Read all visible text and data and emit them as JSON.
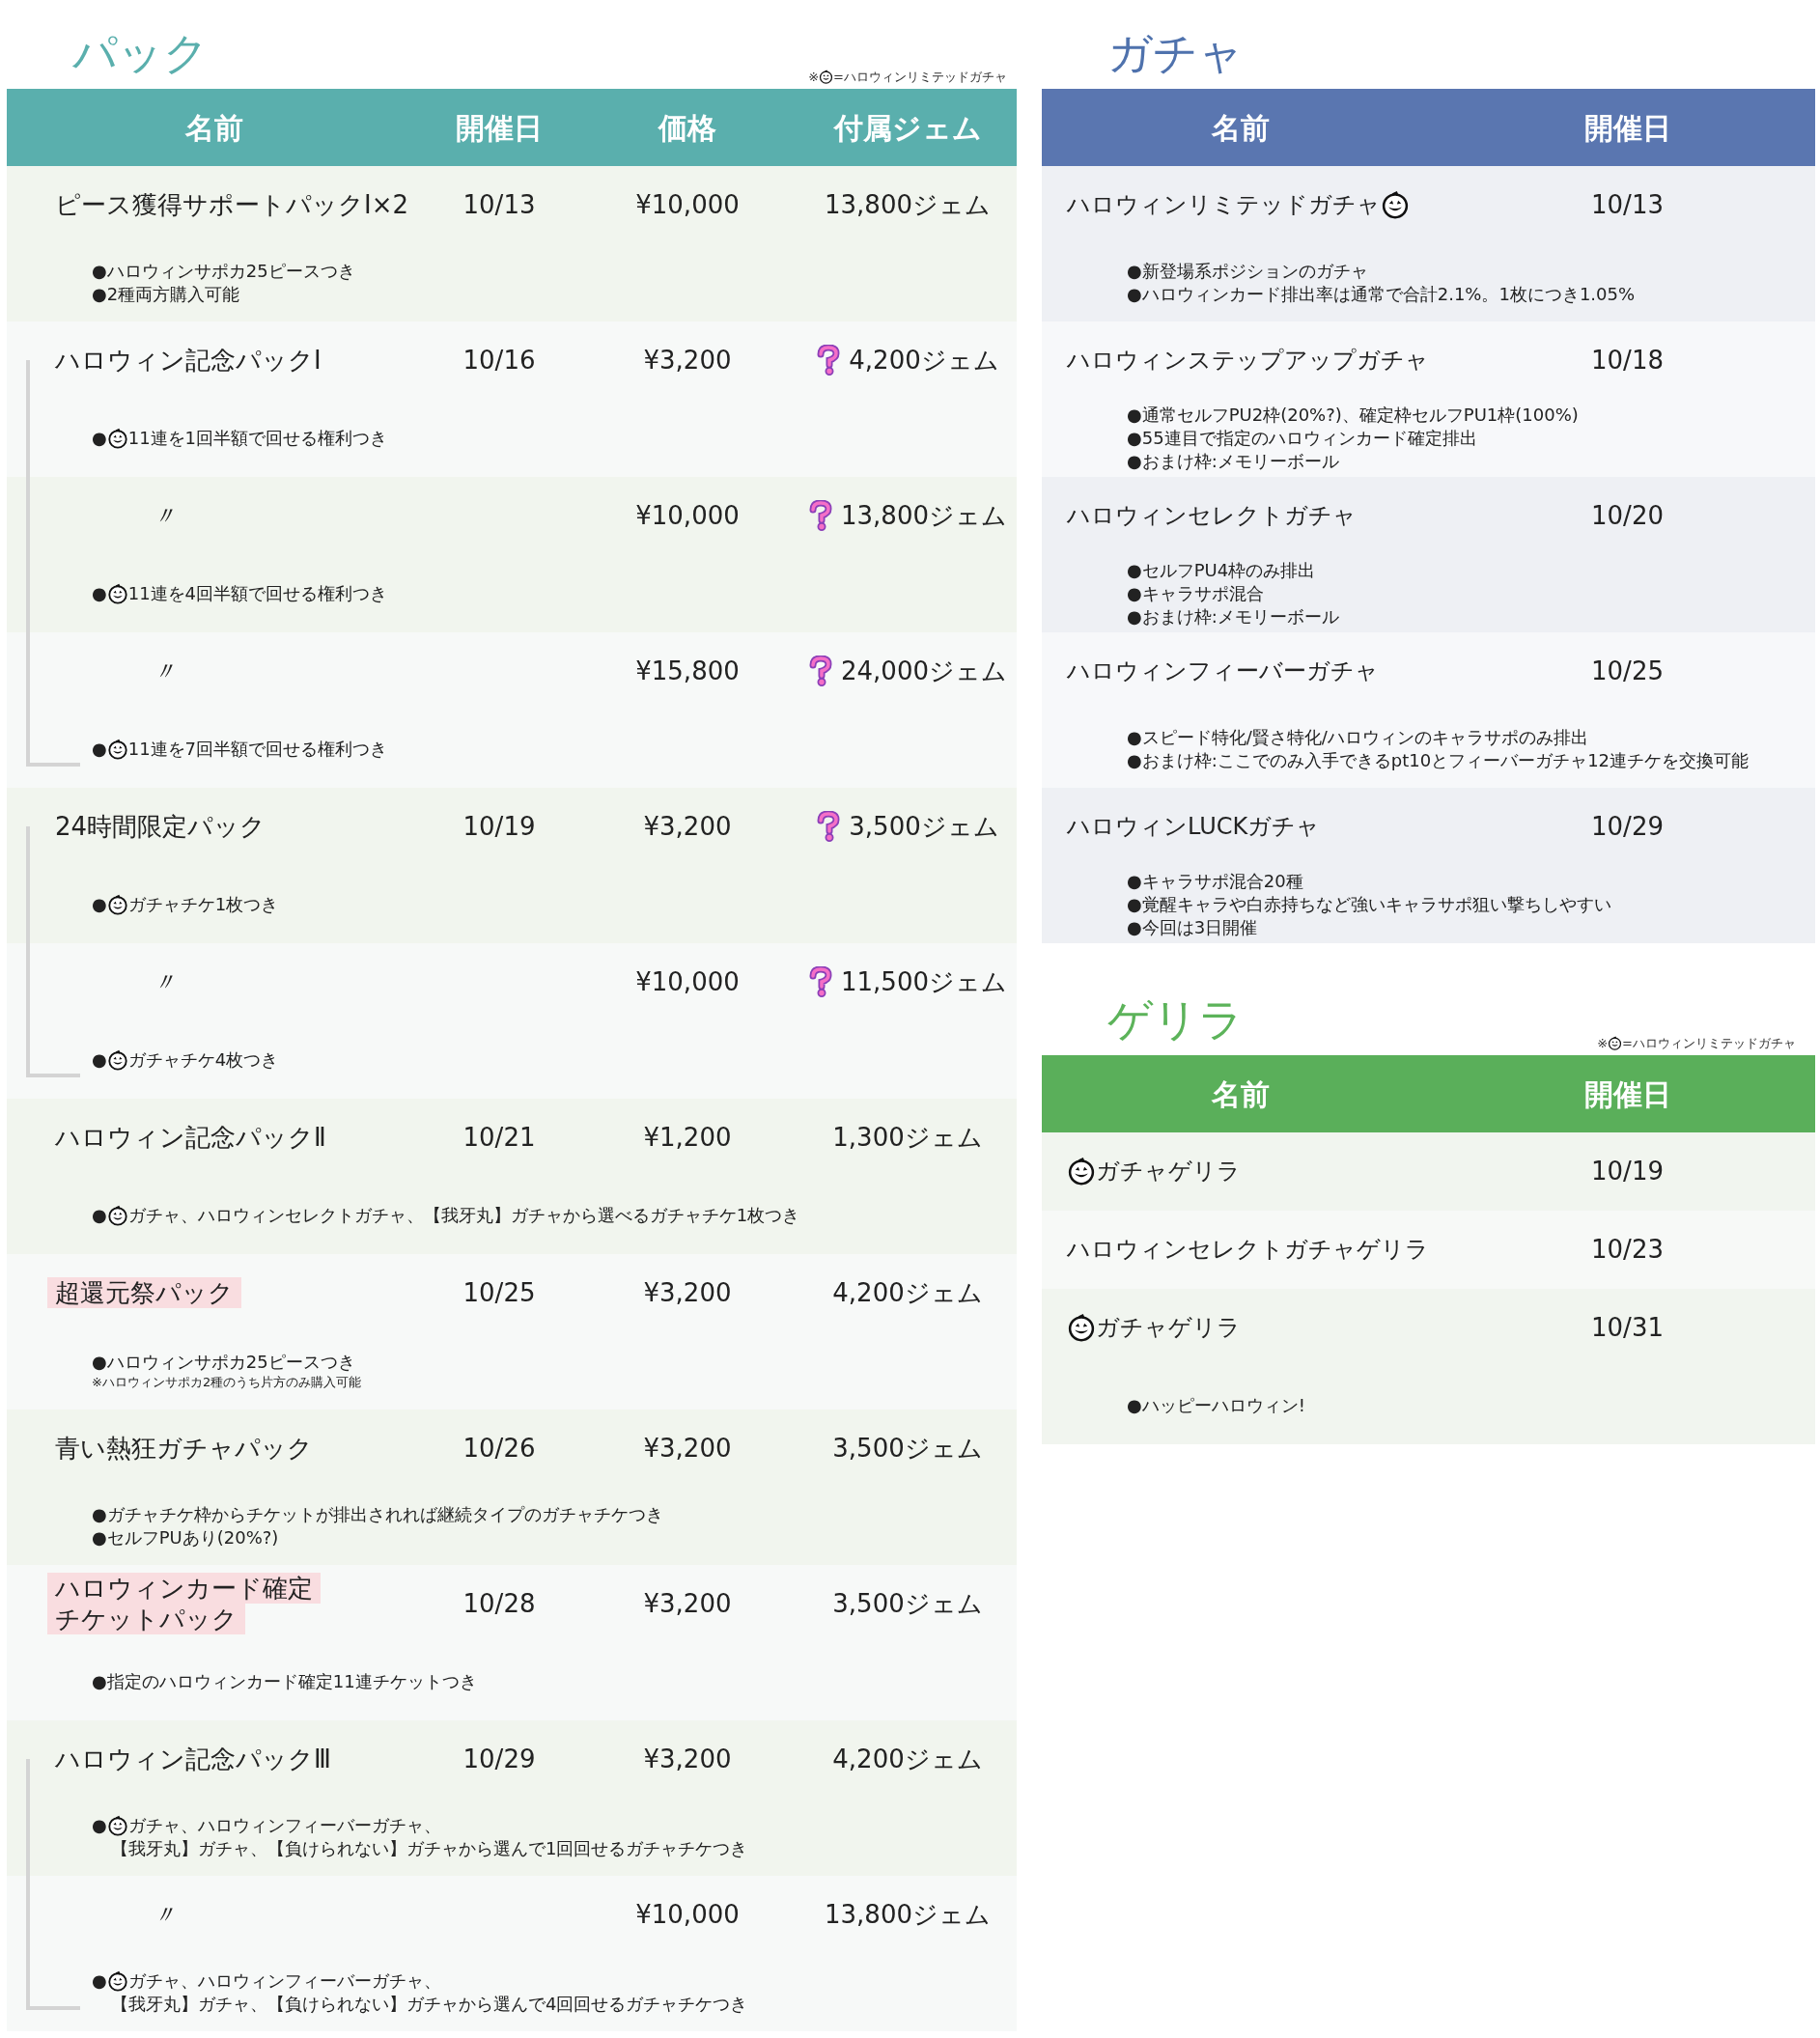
{
  "packs": {
    "title": "パック",
    "legend": {
      "lead": "※",
      "text": "=ハロウィンリミテッドガチャ"
    },
    "columns": [
      "名前",
      "開催日",
      "価格",
      "付属ジェム"
    ],
    "groups": [
      {
        "name": [
          "ピース獲得サポートパックⅠ×2"
        ],
        "date": "10/13",
        "highlight": false,
        "variants": [
          {
            "price": "¥10,000",
            "gems": "13,800ジェム",
            "gem_bonus": false,
            "notes": [
              {
                "text": "●ハロウィンサポカ25ピースつき"
              },
              {
                "text": "●2種両方購入可能"
              }
            ]
          }
        ]
      },
      {
        "name": [
          "ハロウィン記念パックⅠ"
        ],
        "date": "10/16",
        "highlight": false,
        "variants": [
          {
            "price": "¥3,200",
            "gems": "4,200ジェム",
            "gem_bonus": true,
            "notes": [
              {
                "lead": "●",
                "pumpkin": true,
                "text": "11連を1回半額で回せる権利つき"
              }
            ]
          },
          {
            "ditto": "〃",
            "price": "¥10,000",
            "gems": "13,800ジェム",
            "gem_bonus": true,
            "notes": [
              {
                "lead": "●",
                "pumpkin": true,
                "text": "11連を4回半額で回せる権利つき"
              }
            ]
          },
          {
            "ditto": "〃",
            "price": "¥15,800",
            "gems": "24,000ジェム",
            "gem_bonus": true,
            "notes": [
              {
                "lead": "●",
                "pumpkin": true,
                "text": "11連を7回半額で回せる権利つき"
              }
            ]
          }
        ]
      },
      {
        "name": [
          "24時間限定パック"
        ],
        "date": "10/19",
        "highlight": false,
        "variants": [
          {
            "price": "¥3,200",
            "gems": "3,500ジェム",
            "gem_bonus": true,
            "notes": [
              {
                "lead": "●",
                "pumpkin": true,
                "text": "ガチャチケ1枚つき"
              }
            ]
          },
          {
            "ditto": "〃",
            "price": "¥10,000",
            "gems": "11,500ジェム",
            "gem_bonus": true,
            "notes": [
              {
                "lead": "●",
                "pumpkin": true,
                "text": "ガチャチケ4枚つき"
              }
            ]
          }
        ]
      },
      {
        "name": [
          "ハロウィン記念パックⅡ"
        ],
        "date": "10/21",
        "highlight": false,
        "variants": [
          {
            "price": "¥1,200",
            "gems": "1,300ジェム",
            "gem_bonus": false,
            "notes": [
              {
                "lead": "●",
                "pumpkin": true,
                "text": "ガチャ、ハロウィンセレクトガチャ、【我牙丸】ガチャから選べるガチャチケ1枚つき"
              }
            ]
          }
        ]
      },
      {
        "name": [
          "超還元祭パック"
        ],
        "date": "10/25",
        "highlight": true,
        "variants": [
          {
            "price": "¥3,200",
            "gems": "4,200ジェム",
            "gem_bonus": false,
            "notes": [
              {
                "text": "●ハロウィンサポカ25ピースつき"
              },
              {
                "kind": "small",
                "text": "※ハロウィンサポカ2種のうち片方のみ購入可能"
              }
            ]
          }
        ]
      },
      {
        "name": [
          "青い熱狂ガチャパック"
        ],
        "date": "10/26",
        "highlight": false,
        "variants": [
          {
            "price": "¥3,200",
            "gems": "3,500ジェム",
            "gem_bonus": false,
            "notes": [
              {
                "text": "●ガチャチケ枠からチケットが排出されれば継続タイプのガチャチケつき"
              },
              {
                "text": "●セルフPUあり(20%?)"
              }
            ]
          }
        ]
      },
      {
        "name": [
          "ハロウィンカード確定",
          "チケットパック"
        ],
        "date": "10/28",
        "highlight": true,
        "variants": [
          {
            "price": "¥3,200",
            "gems": "3,500ジェム",
            "gem_bonus": false,
            "notes": [
              {
                "text": "●指定のハロウィンカード確定11連チケットつき"
              }
            ]
          }
        ]
      },
      {
        "name": [
          "ハロウィン記念パックⅢ"
        ],
        "date": "10/29",
        "highlight": false,
        "variants": [
          {
            "price": "¥3,200",
            "gems": "4,200ジェム",
            "gem_bonus": false,
            "notes": [
              {
                "lead": "●",
                "pumpkin": true,
                "text": "ガチャ、ハロウィンフィーバーガチャ、"
              },
              {
                "kind": "continuation",
                "text": "【我牙丸】ガチャ、【負けられない】ガチャから選んで1回回せるガチャチケつき"
              }
            ]
          },
          {
            "ditto": "〃",
            "price": "¥10,000",
            "gems": "13,800ジェム",
            "gem_bonus": false,
            "notes": [
              {
                "lead": "●",
                "pumpkin": true,
                "text": "ガチャ、ハロウィンフィーバーガチャ、"
              },
              {
                "kind": "continuation",
                "text": "【我牙丸】ガチャ、【負けられない】ガチャから選んで4回回せるガチャチケつき"
              }
            ]
          }
        ]
      }
    ]
  },
  "gacha": {
    "title": "ガチャ",
    "columns": [
      "名前",
      "開催日"
    ],
    "rows": [
      {
        "name": "ハロウィンリミテッドガチャ",
        "pumpkin_before": false,
        "pumpkin_after": true,
        "date": "10/13",
        "notes": [
          {
            "text": "●新登場系ポジションのガチャ"
          },
          {
            "text": "●ハロウィンカード排出率は通常で合計2.1%。1枚につき1.05%"
          }
        ]
      },
      {
        "name": "ハロウィンステップアップガチャ",
        "pumpkin_before": false,
        "pumpkin_after": false,
        "date": "10/18",
        "notes": [
          {
            "text": "●通常セルフPU2枠(20%?)、確定枠セルフPU1枠(100%)"
          },
          {
            "text": "●55連目で指定のハロウィンカード確定排出"
          },
          {
            "text": "●おまけ枠:メモリーボール"
          }
        ]
      },
      {
        "name": "ハロウィンセレクトガチャ",
        "pumpkin_before": false,
        "pumpkin_after": false,
        "date": "10/20",
        "notes": [
          {
            "text": "●セルフPU4枠のみ排出"
          },
          {
            "text": "●キャラサポ混合"
          },
          {
            "text": "●おまけ枠:メモリーボール"
          }
        ]
      },
      {
        "name": "ハロウィンフィーバーガチャ",
        "pumpkin_before": false,
        "pumpkin_after": false,
        "date": "10/25",
        "notes": [
          {
            "text": "●スピード特化/賢さ特化/ハロウィンのキャラサポのみ排出"
          },
          {
            "text": "●おまけ枠:ここでのみ入手できるpt10とフィーバーガチャ12連チケを交換可能"
          }
        ]
      },
      {
        "name": "ハロウィンLUCKガチャ",
        "pumpkin_before": false,
        "pumpkin_after": false,
        "date": "10/29",
        "notes": [
          {
            "text": "●キャラサポ混合20種"
          },
          {
            "text": "●覚醒キャラや白赤持ちなど強いキャラサポ狙い撃ちしやすい"
          },
          {
            "text": "●今回は3日開催"
          }
        ]
      }
    ]
  },
  "guerrilla": {
    "title": "ゲリラ",
    "legend": {
      "lead": "※",
      "text": "=ハロウィンリミテッドガチャ"
    },
    "columns": [
      "名前",
      "開催日"
    ],
    "rows": [
      {
        "name": "ガチャゲリラ",
        "pumpkin_before": true,
        "pumpkin_after": false,
        "date": "10/19"
      },
      {
        "name": "ハロウィンセレクトガチャゲリラ",
        "pumpkin_before": false,
        "pumpkin_after": false,
        "date": "10/23"
      },
      {
        "name": "ガチャゲリラ",
        "pumpkin_before": true,
        "pumpkin_after": false,
        "date": "10/31",
        "notes": [
          {
            "text": "●ハッピーハロウィン!"
          }
        ]
      }
    ]
  }
}
